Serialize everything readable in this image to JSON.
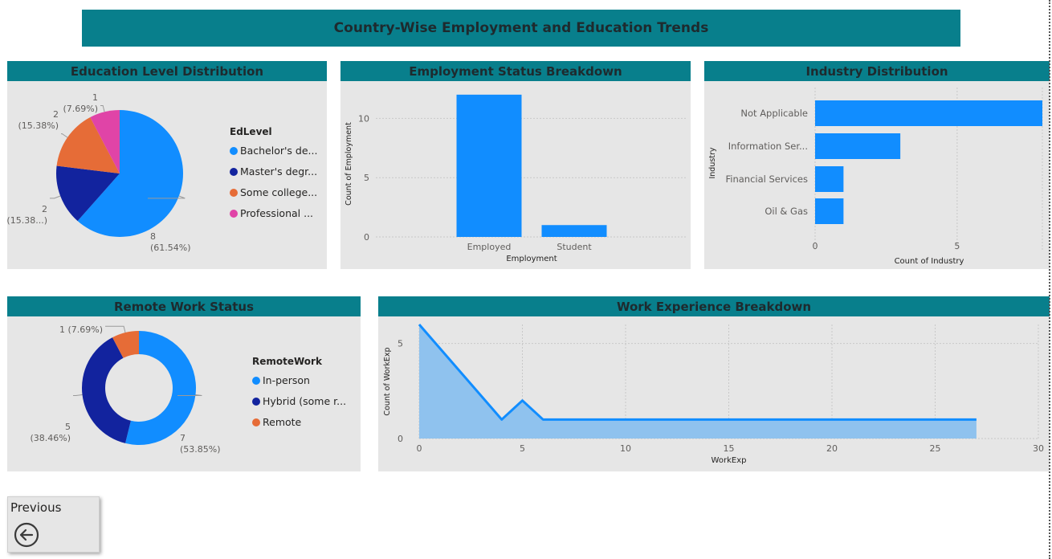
{
  "page": {
    "title": "Country-Wise Employment and Education Trends",
    "previous_label": "Previous"
  },
  "colors": {
    "header": "#087F8C",
    "card_bg": "#E6E6E6",
    "blue": "#118DFF",
    "navy": "#12239E",
    "orange": "#E66C37",
    "magenta": "#E044A7",
    "area_fill": "#8FC2EE"
  },
  "chart_data": [
    {
      "id": "education",
      "type": "pie",
      "title": "Education Level Distribution",
      "legend_title": "EdLevel",
      "legend_position": "right",
      "slices": [
        {
          "name": "Bachelor's de...",
          "value": 8,
          "label": "8",
          "pct_label": "(61.54%)",
          "color": "#118DFF"
        },
        {
          "name": "Master's degr...",
          "value": 2,
          "label": "2",
          "pct_label": "(15.38...)",
          "color": "#12239E"
        },
        {
          "name": "Some college...",
          "value": 2,
          "label": "2",
          "pct_label": "(15.38%)",
          "color": "#E66C37"
        },
        {
          "name": "Professional ...",
          "value": 1,
          "label": "1",
          "pct_label": "(7.69%)",
          "color": "#E044A7"
        }
      ]
    },
    {
      "id": "employment",
      "type": "bar",
      "title": "Employment Status Breakdown",
      "categories": [
        "Employed",
        "Student"
      ],
      "values": [
        12,
        1
      ],
      "xlabel": "Employment",
      "ylabel": "Count of Employment",
      "yticks": [
        0,
        5,
        10
      ],
      "ylim": [
        0,
        12.6
      ],
      "grid": true
    },
    {
      "id": "industry",
      "type": "bar",
      "orientation": "horizontal",
      "title": "Industry Distribution",
      "categories": [
        "Not Applicable",
        "Information Ser...",
        "Financial Services",
        "Oil & Gas"
      ],
      "values": [
        8,
        3,
        1,
        1
      ],
      "xlabel": "Count of Industry",
      "ylabel": "Industry",
      "xticks": [
        0,
        5
      ],
      "xlim": [
        0,
        8
      ],
      "grid": true
    },
    {
      "id": "remote",
      "type": "pie",
      "donut": true,
      "title": "Remote Work Status",
      "legend_title": "RemoteWork",
      "legend_position": "right",
      "slices": [
        {
          "name": "In-person",
          "value": 7,
          "label": "7",
          "pct_label": "(53.85%)",
          "color": "#118DFF"
        },
        {
          "name": "Hybrid (some r...",
          "value": 5,
          "label": "5",
          "pct_label": "(38.46%)",
          "color": "#12239E"
        },
        {
          "name": "Remote",
          "value": 1,
          "label": "1 (7.69%)",
          "pct_label": "",
          "color": "#E66C37"
        }
      ]
    },
    {
      "id": "workexp",
      "type": "area",
      "title": "Work Experience Breakdown",
      "x": [
        0,
        4,
        5,
        6,
        27
      ],
      "y": [
        6,
        1,
        2,
        1,
        1
      ],
      "xlabel": "WorkExp",
      "ylabel": "Count of WorkExp",
      "xticks": [
        0,
        5,
        10,
        15,
        20,
        25,
        30
      ],
      "yticks": [
        0,
        5
      ],
      "xlim": [
        0,
        30
      ],
      "ylim": [
        0,
        6
      ],
      "grid": true
    }
  ]
}
